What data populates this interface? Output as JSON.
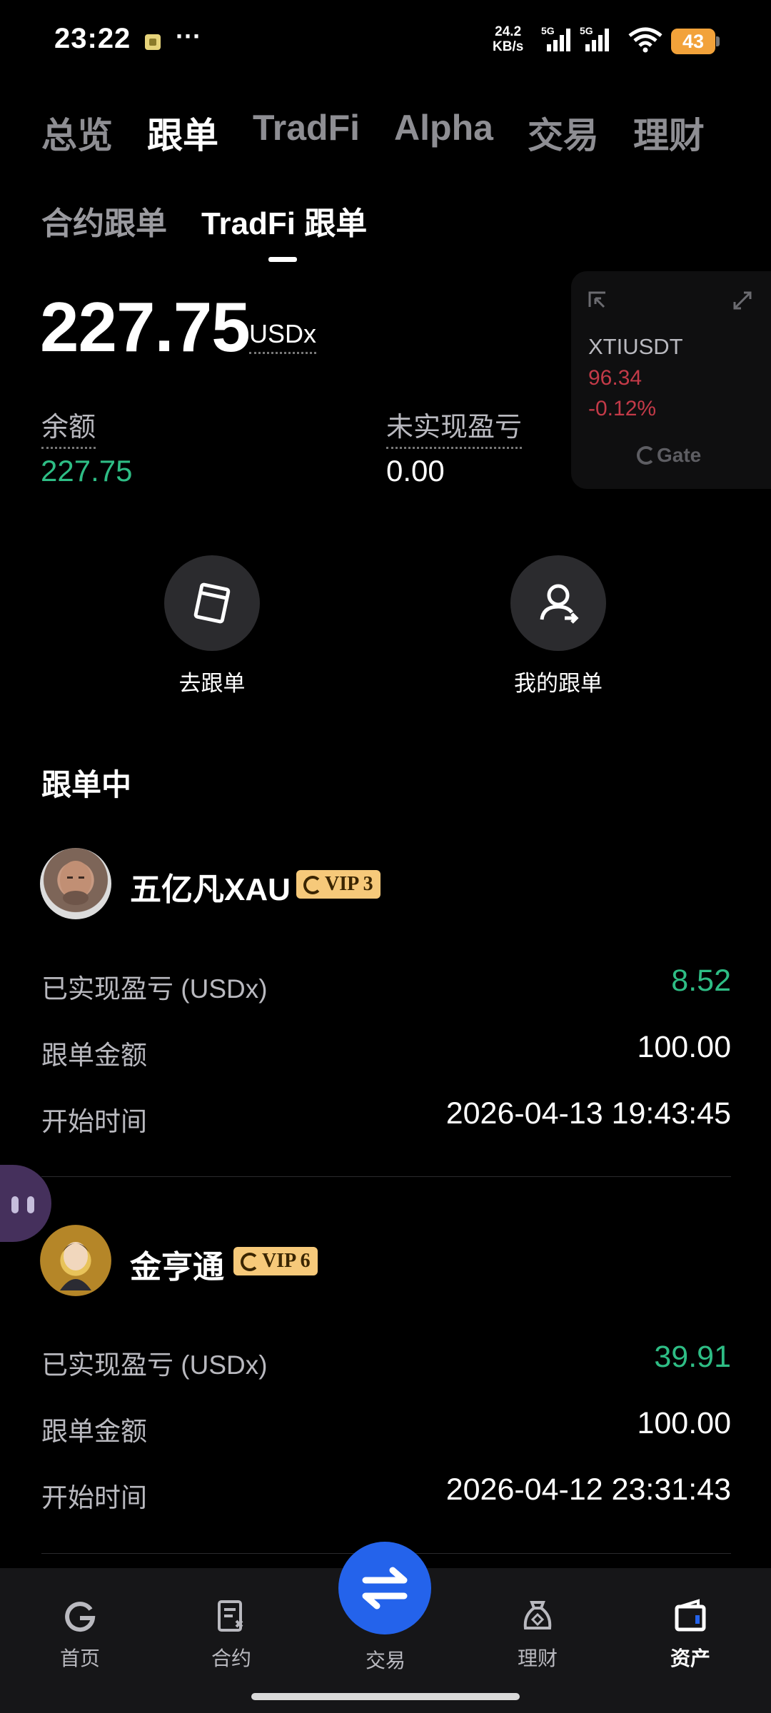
{
  "status_bar": {
    "time": "23:22",
    "more": "···",
    "net_speed_value": "24.2",
    "net_speed_unit": "KB/s",
    "sim1_label": "5G",
    "sim2_label": "5G",
    "battery": "43",
    "battery_color": "#f2a23a"
  },
  "tabs": [
    "总览",
    "跟单",
    "TradFi",
    "Alpha",
    "交易",
    "理财"
  ],
  "active_tab_index": 1,
  "subtabs": [
    "合约跟单",
    "TradFi 跟单"
  ],
  "active_subtab_index": 1,
  "account": {
    "total_amount": "227.75",
    "unit": "USDx",
    "balance_label": "余额",
    "balance_value": "227.75",
    "unrealized_label": "未实现盈亏",
    "unrealized_value": "0.00"
  },
  "ticker_widget": {
    "symbol": "XTIUSDT",
    "price": "96.34",
    "change": "-0.12%",
    "brand": "Gate"
  },
  "actions": [
    {
      "label": "去跟单",
      "icon": "copy-card-icon"
    },
    {
      "label": "我的跟单",
      "icon": "user-follow-icon"
    }
  ],
  "section_title": "跟单中",
  "traders": [
    {
      "name": "五亿凡XAU",
      "vip": "VIP 3",
      "realized_label": "已实现盈亏 (USDx)",
      "realized_value": "8.52",
      "amount_label": "跟单金额",
      "amount_value": "100.00",
      "start_label": "开始时间",
      "start_value": "2026-04-13 19:43:45"
    },
    {
      "name": "金亨通",
      "vip": "VIP 6",
      "realized_label": "已实现盈亏 (USDx)",
      "realized_value": "39.91",
      "amount_label": "跟单金额",
      "amount_value": "100.00",
      "start_label": "开始时间",
      "start_value": "2026-04-12 23:31:43"
    }
  ],
  "bottom_nav": [
    {
      "label": "首页",
      "icon": "home-icon"
    },
    {
      "label": "合约",
      "icon": "contract-icon"
    },
    {
      "label": "交易",
      "icon": "swap-icon"
    },
    {
      "label": "理财",
      "icon": "finance-icon"
    },
    {
      "label": "资产",
      "icon": "wallet-icon",
      "active": true
    }
  ],
  "colors": {
    "positive": "#2ebd85",
    "negative": "#c33a48",
    "accent": "#2463eb",
    "vip_badge": "#f6c97a"
  }
}
